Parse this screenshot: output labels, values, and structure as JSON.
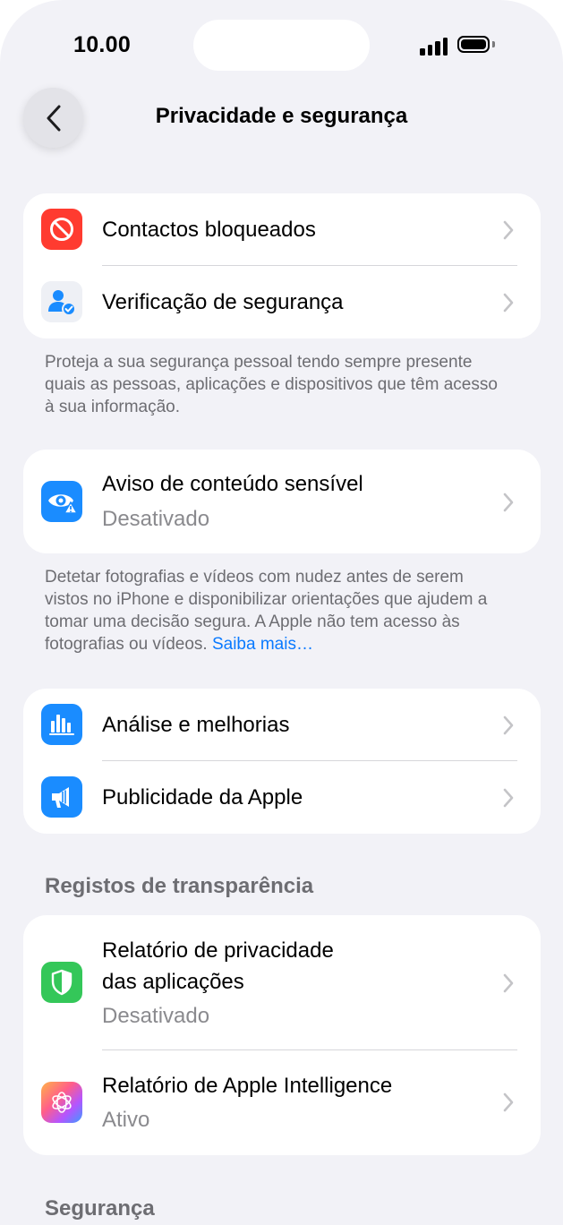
{
  "status": {
    "time": "10.00"
  },
  "nav": {
    "title": "Privacidade e segurança"
  },
  "group1": {
    "items": [
      {
        "label": "Contactos bloqueados"
      },
      {
        "label": "Verificação de segurança"
      }
    ],
    "footnote": "Proteja a sua segurança pessoal tendo sempre presente quais as pessoas, aplicações e dispositivos que têm acesso à sua informação."
  },
  "group2": {
    "item": {
      "label": "Aviso de conteúdo sensível",
      "value": "Desativado"
    },
    "footnote": "Detetar fotografias e vídeos com nudez antes de serem vistos no iPhone e disponibilizar orientações que ajudem a tomar uma decisão segura. A Apple não tem acesso às fotografias ou vídeos.",
    "link": "Saiba mais…"
  },
  "group3": {
    "items": [
      {
        "label": "Análise e melhorias"
      },
      {
        "label": "Publicidade da Apple"
      }
    ]
  },
  "transparency": {
    "header": "Registos de transparência",
    "items": [
      {
        "label_line1": "Relatório de privacidade",
        "label_line2": "das aplicações",
        "value": "Desativado"
      },
      {
        "label": "Relatório de Apple Intelligence",
        "value": "Ativo"
      }
    ]
  },
  "security": {
    "header": "Segurança"
  },
  "colors": {
    "background": "#f2f2f7",
    "accent": "#0a7aff",
    "red": "#ff3b30",
    "blue": "#1a8cff",
    "green": "#34c759"
  },
  "icons": [
    "back-chevron-icon",
    "blocked-icon",
    "safety-check-icon",
    "sensitive-content-eye-icon",
    "analytics-icon",
    "advertising-megaphone-icon",
    "app-privacy-shield-icon",
    "apple-intelligence-icon",
    "chevron-right-icon"
  ]
}
